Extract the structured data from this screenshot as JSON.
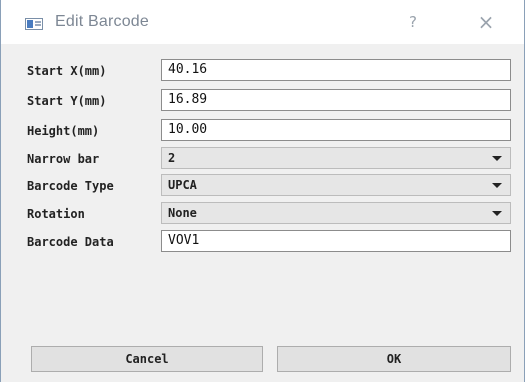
{
  "window": {
    "title": "Edit Barcode",
    "help_label": "?",
    "close_label": "×"
  },
  "form": {
    "start_x": {
      "label": "Start X(mm)",
      "value": "40.16"
    },
    "start_y": {
      "label": "Start Y(mm)",
      "value": "16.89"
    },
    "height": {
      "label": "Height(mm)",
      "value": "10.00"
    },
    "narrow_bar": {
      "label": "Narrow bar",
      "selected": "2"
    },
    "barcode_type": {
      "label": "Barcode Type",
      "selected": "UPCA"
    },
    "rotation": {
      "label": "Rotation",
      "selected": "None"
    },
    "barcode_data": {
      "label": "Barcode Data",
      "value": "VOV1"
    }
  },
  "buttons": {
    "cancel_label": "Cancel",
    "ok_label": "OK"
  },
  "icons": {
    "app": "barcode-app-icon",
    "help": "help-icon",
    "close": "close-icon",
    "dropdown": "chevron-down-icon"
  }
}
